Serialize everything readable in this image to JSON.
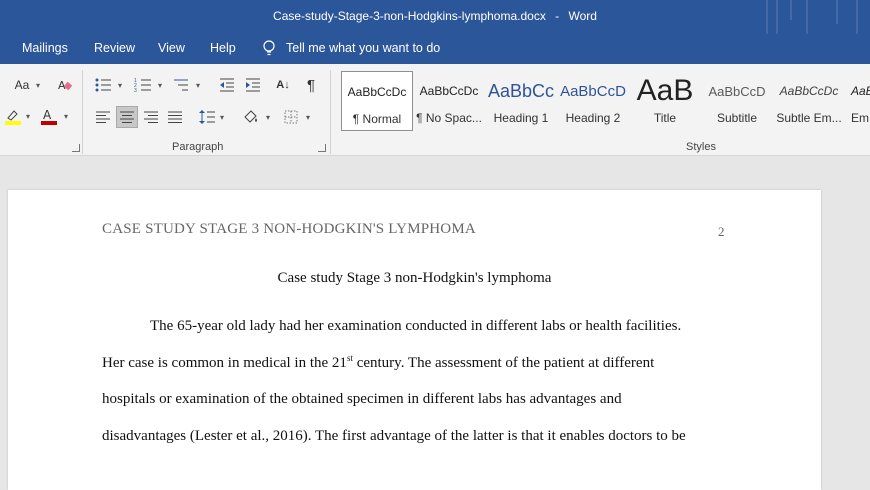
{
  "titlebar": {
    "doc_name": "Case-study-Stage-3-non-Hodgkins-lymphoma.docx",
    "separator": "-",
    "app": "Word"
  },
  "tabs": [
    "Mailings",
    "Review",
    "View",
    "Help"
  ],
  "tell_me": "Tell me what you want to do",
  "ribbon": {
    "font_size_glyph": "Aa",
    "paragraph_label": "Paragraph",
    "styles_label": "Styles",
    "pilcrow": "¶",
    "sort_glyph": "A↓"
  },
  "styles": [
    {
      "preview": "AaBbCcDc",
      "name": "¶ Normal",
      "color": "#222222"
    },
    {
      "preview": "AaBbCcDc",
      "name": "¶ No Spac...",
      "color": "#222222"
    },
    {
      "preview": "AaBbCc",
      "name": "Heading 1",
      "color": "#2f5496"
    },
    {
      "preview": "AaBbCcD",
      "name": "Heading 2",
      "color": "#2f5496"
    },
    {
      "preview": "AaB",
      "name": "Title",
      "color": "#222222"
    },
    {
      "preview": "AaBbCcD",
      "name": "Subtitle",
      "color": "#5a5a5a"
    },
    {
      "preview": "AaBbCcDc",
      "name": "Subtle Em...",
      "color": "#404040"
    },
    {
      "preview": "AaBbCcDc",
      "name": "Em",
      "color": "#222222"
    }
  ],
  "document": {
    "running_header": "CASE STUDY STAGE 3 NON-HODGKIN'S LYMPHOMA",
    "page_number": "2",
    "title": "Case study Stage 3 non-Hodgkin's lymphoma",
    "line1": "The 65-year old lady had her examination conducted in different labs or health facilities.",
    "line2_a": "Her case is common in medical in the 21",
    "line2_sup": "st",
    "line2_b": " century. The assessment of the patient at different",
    "line3": "hospitals or examination of the obtained specimen in different labs has advantages and",
    "line4": "disadvantages (Lester et al., 2016). The first advantage of the latter is that it enables doctors to be"
  },
  "colors": {
    "brand": "#2b579a",
    "ribbon_bg": "#f3f3f3",
    "canvas_bg": "#e6e6e6",
    "font_color_underline": "#c00000",
    "highlight": "#ffff00"
  }
}
